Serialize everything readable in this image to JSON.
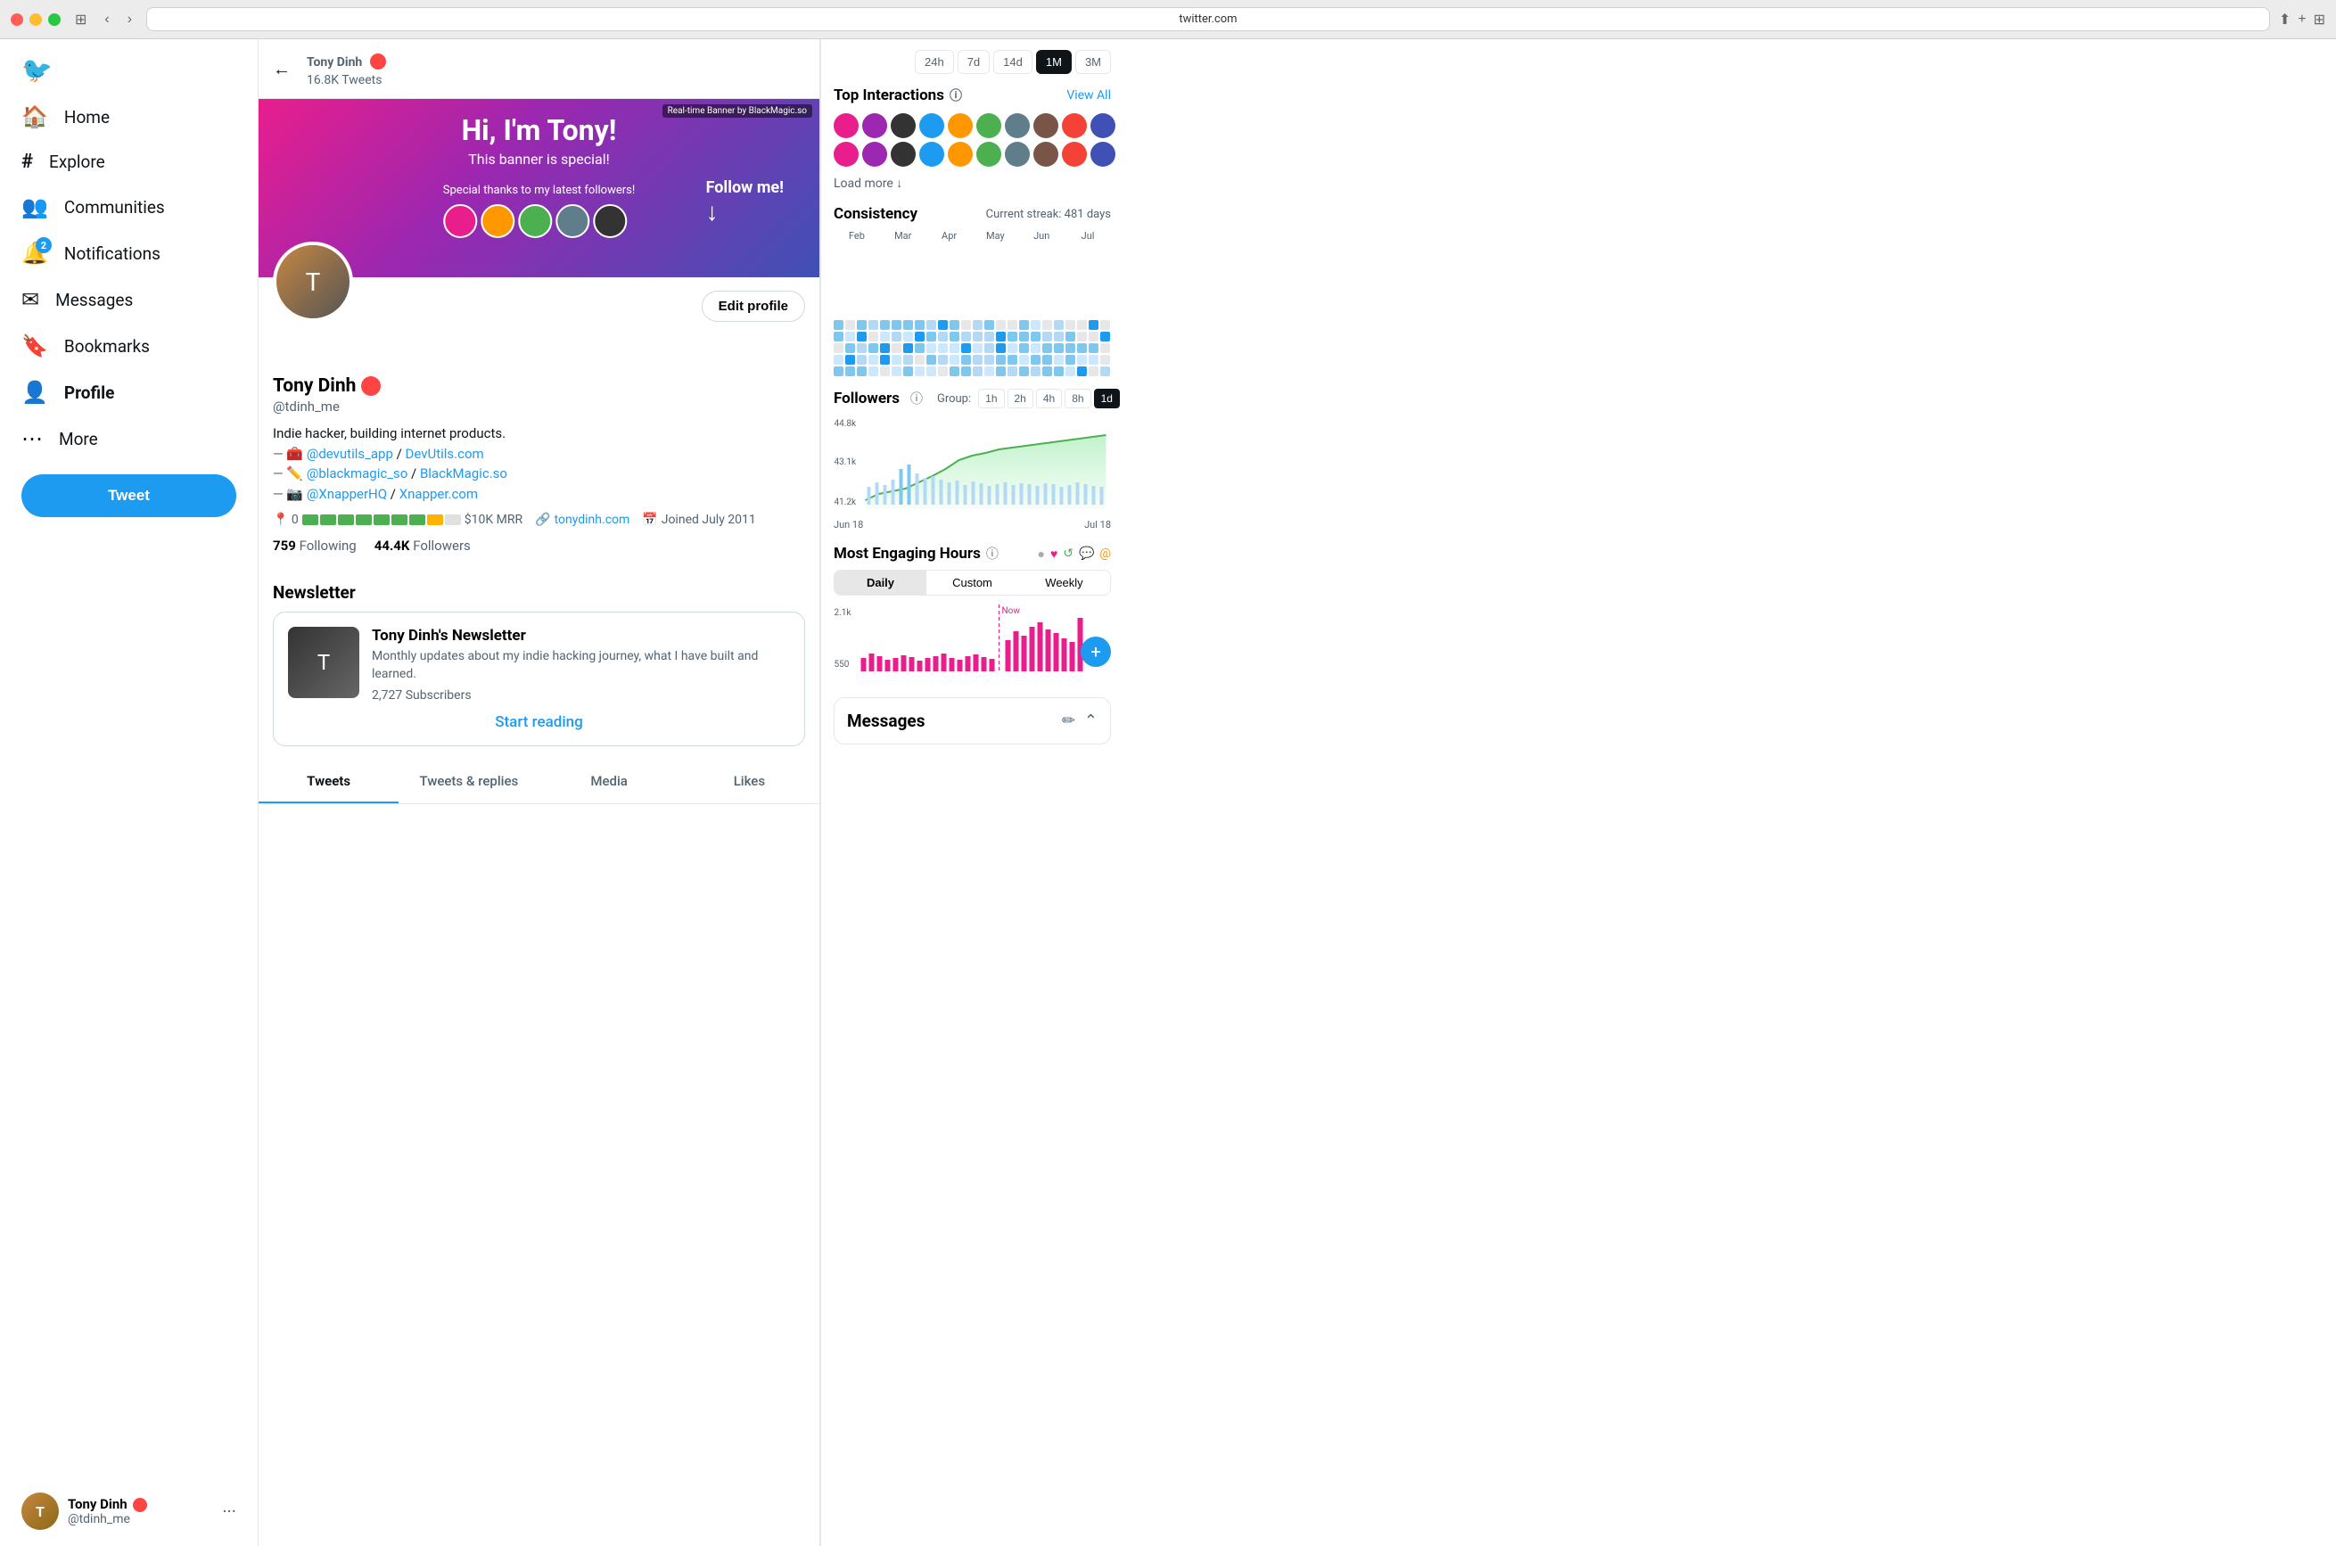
{
  "browser": {
    "url": "twitter.com"
  },
  "sidebar": {
    "logo": "🐦",
    "nav_items": [
      {
        "id": "home",
        "label": "Home",
        "icon": "🏠"
      },
      {
        "id": "explore",
        "label": "Explore",
        "icon": "#"
      },
      {
        "id": "communities",
        "label": "Communities",
        "icon": "👥"
      },
      {
        "id": "notifications",
        "label": "Notifications",
        "icon": "🔔",
        "badge": "2"
      },
      {
        "id": "messages",
        "label": "Messages",
        "icon": "✉"
      },
      {
        "id": "bookmarks",
        "label": "Bookmarks",
        "icon": "🔖"
      },
      {
        "id": "profile",
        "label": "Profile",
        "icon": "👤"
      },
      {
        "id": "more",
        "label": "More",
        "icon": "⋯"
      }
    ],
    "tweet_btn": "Tweet",
    "user": {
      "name": "Tony Dinh",
      "handle": "@tdinh_me"
    }
  },
  "profile": {
    "back": "←",
    "name": "Tony Dinh",
    "tweets_count": "16.8K Tweets",
    "handle": "@tdinh_me",
    "bio_line1": "Indie hacker, building internet products.",
    "bio_devutils": "@devutils_app",
    "bio_devutils_link": "DevUtils.com",
    "bio_blackmagic": "@blackmagic_so",
    "bio_blackmagic_link": "BlackMagic.so",
    "bio_xnapper": "@XnapperHQ",
    "bio_xnapper_link": "Xnapper.com",
    "mrr_target": "$10K MRR",
    "website": "tonydinh.com",
    "joined": "Joined July 2011",
    "following": "759",
    "following_label": "Following",
    "followers": "44.4K",
    "followers_label": "Followers",
    "edit_profile_label": "Edit profile",
    "newsletter_section_label": "Newsletter",
    "newsletter_title": "Tony Dinh's Newsletter",
    "newsletter_desc": "Monthly updates about my indie hacking journey, what I have built and learned.",
    "newsletter_subscribers": "2,727 Subscribers",
    "start_reading_label": "Start reading",
    "tabs": [
      {
        "id": "tweets",
        "label": "Tweets",
        "active": true
      },
      {
        "id": "tweets_replies",
        "label": "Tweets & replies"
      },
      {
        "id": "media",
        "label": "Media"
      },
      {
        "id": "likes",
        "label": "Likes"
      }
    ],
    "banner_title": "Hi, I'm Tony!",
    "banner_subtitle": "This banner is special!",
    "banner_thanks": "Special thanks to my latest followers!",
    "banner_follow": "Follow me!",
    "banner_watermark": "Real-time Banner by BlackMagic.so"
  },
  "right_panel": {
    "time_buttons": [
      {
        "label": "24h"
      },
      {
        "label": "7d"
      },
      {
        "label": "14d"
      },
      {
        "label": "1M",
        "active": true
      },
      {
        "label": "3M"
      }
    ],
    "top_interactions_title": "Top Interactions",
    "view_all_label": "View All",
    "load_more_label": "Load more ↓",
    "consistency_title": "Consistency",
    "current_streak": "Current streak: 481 days",
    "month_labels": [
      "Feb",
      "Mar",
      "Apr",
      "May",
      "Jun",
      "Jul"
    ],
    "followers_title": "Followers",
    "group_label": "Group:",
    "group_btns": [
      "1h",
      "2h",
      "4h",
      "8h",
      "1d"
    ],
    "followers_y": [
      "44.8k",
      "43.1k",
      "41.2k"
    ],
    "followers_x": [
      "Jun 18",
      "Jul 18"
    ],
    "engaging_title": "Most Engaging Hours",
    "daily_tabs": [
      {
        "label": "Daily",
        "active": true
      },
      {
        "label": "Custom"
      },
      {
        "label": "Weekly"
      }
    ],
    "now_label": "Now",
    "y_labels_engaging": [
      "2.1k",
      "550"
    ],
    "messages_title": "Messages"
  }
}
